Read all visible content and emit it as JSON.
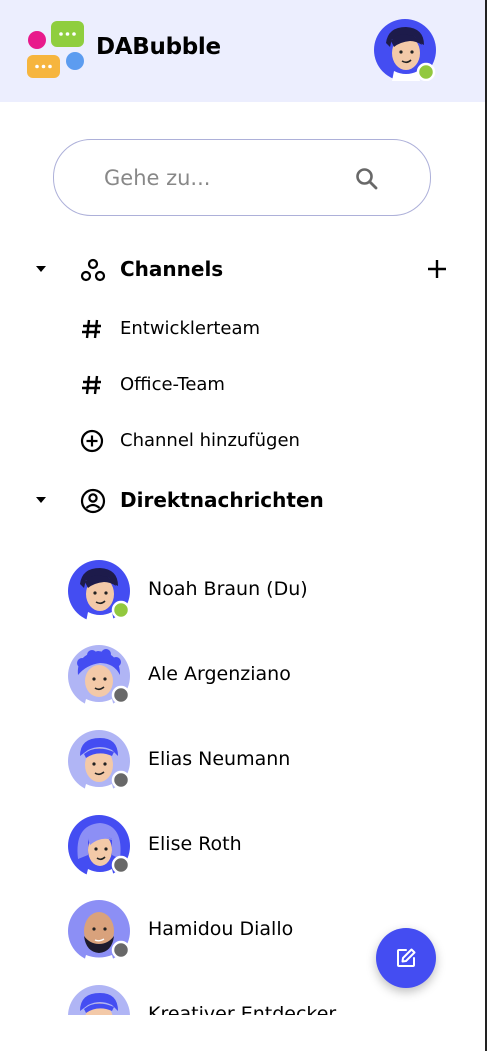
{
  "app": {
    "brand": "DABubble"
  },
  "header": {
    "user_status": "online"
  },
  "search": {
    "placeholder": "Gehe zu..."
  },
  "channels": {
    "title": "Channels",
    "items": [
      {
        "label": "Entwicklerteam",
        "icon": "hash-icon"
      },
      {
        "label": "Office-Team",
        "icon": "hash-icon"
      }
    ],
    "add_label": "Channel hinzufügen"
  },
  "direct_messages": {
    "title": "Direktnachrichten",
    "users": [
      {
        "name": "Noah Braun (Du)",
        "status": "online"
      },
      {
        "name": "Ale Argenziano",
        "status": "offline"
      },
      {
        "name": "Elias Neumann",
        "status": "offline"
      },
      {
        "name": "Elise Roth",
        "status": "offline"
      },
      {
        "name": "Hamidou Diallo",
        "status": "offline"
      },
      {
        "name": "Kreativer Entdecker",
        "status": "offline"
      }
    ]
  },
  "colors": {
    "accent": "#444df2",
    "header_bg": "#eceefe",
    "online": "#92c83e",
    "offline": "#686868"
  }
}
